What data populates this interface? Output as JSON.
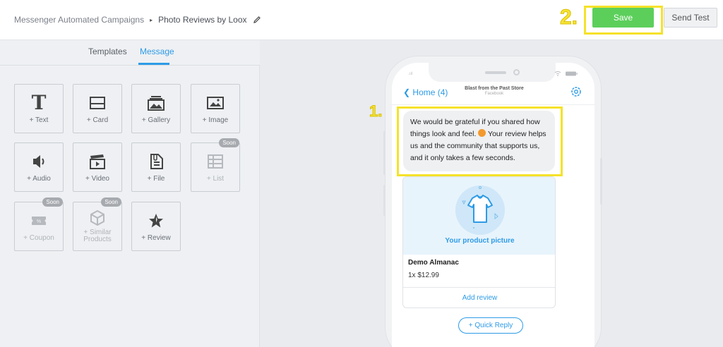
{
  "breadcrumb": {
    "parent": "Messenger Automated Campaigns",
    "separator": "▸",
    "current": "Photo Reviews by Loox"
  },
  "annotations": {
    "step1": "1.",
    "step2": "2."
  },
  "toolbar": {
    "save_label": "Save",
    "send_test_label": "Send Test"
  },
  "left_panel": {
    "tabs": [
      {
        "label": "Templates",
        "active": false
      },
      {
        "label": "Message",
        "active": true
      }
    ],
    "tiles": [
      {
        "label": "+ Text",
        "icon": "text-icon",
        "disabled": false
      },
      {
        "label": "+ Card",
        "icon": "card-icon",
        "disabled": false
      },
      {
        "label": "+ Gallery",
        "icon": "gallery-icon",
        "disabled": false
      },
      {
        "label": "+ Image",
        "icon": "image-icon",
        "disabled": false
      },
      {
        "label": "+ Audio",
        "icon": "audio-icon",
        "disabled": false
      },
      {
        "label": "+ Video",
        "icon": "video-icon",
        "disabled": false
      },
      {
        "label": "+ File",
        "icon": "file-icon",
        "disabled": false
      },
      {
        "label": "+ List",
        "icon": "list-icon",
        "disabled": true,
        "badge": "Soon"
      },
      {
        "label": "+ Coupon",
        "icon": "coupon-icon",
        "disabled": true,
        "badge": "Soon"
      },
      {
        "label": "+ Similar Products",
        "icon": "box-icon",
        "disabled": true,
        "badge": "Soon"
      },
      {
        "label": "+ Review",
        "icon": "star-icon",
        "disabled": false
      }
    ]
  },
  "preview": {
    "back_label": "Home (4)",
    "store_name": "Blast from the Past Store",
    "store_sub": "Facebook",
    "message_text": "We would be grateful if you shared how things look and feel.",
    "message_text_2": " Your review helps us and the community that supports us, and it only takes a few seconds.",
    "card": {
      "image_caption": "Your product picture",
      "title": "Demo Almanac",
      "price": "1x $12.99",
      "button_label": "Add review"
    },
    "quick_reply_label": "+ Quick Reply"
  },
  "colors": {
    "accent": "#2d9be6",
    "save": "#5ccf5b",
    "highlight": "#f5e22a"
  }
}
